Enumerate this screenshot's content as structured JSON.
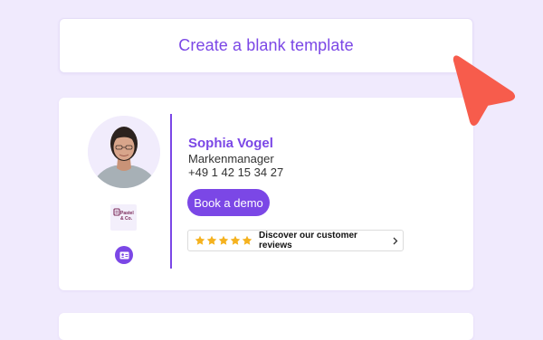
{
  "blank_template": {
    "label": "Create a blank template"
  },
  "signature": {
    "name": "Sophia Vogel",
    "role": "Markenmanager",
    "phone": "+49 1 42 15 34 27",
    "company_logo_text": [
      "Pastel",
      "& Co."
    ],
    "cta_label": "Book a demo",
    "reviews": {
      "stars": 5,
      "label": "Discover our customer reviews"
    }
  },
  "icons": {
    "vcard": "contact-card-icon",
    "star": "star-icon",
    "chevron": "chevron-right-icon",
    "cursor": "pointer-cursor-icon"
  },
  "colors": {
    "accent": "#7b47e6",
    "background": "#f0eafd",
    "star": "#f5b21f",
    "cursor": "#f75c4c"
  }
}
